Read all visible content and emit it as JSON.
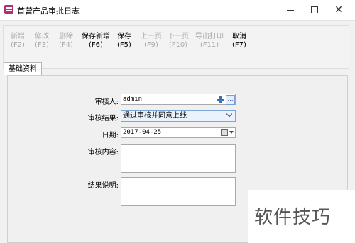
{
  "window": {
    "title": "首营产品审批日志"
  },
  "toolbar": {
    "buttons": [
      {
        "label": "新增",
        "key": "(F2)",
        "enabled": false
      },
      {
        "label": "修改",
        "key": "(F3)",
        "enabled": false
      },
      {
        "label": "删除",
        "key": "(F4)",
        "enabled": false
      },
      {
        "label": "保存新增",
        "key": "(F6)",
        "enabled": true
      },
      {
        "label": "保存",
        "key": "(F5)",
        "enabled": true
      },
      {
        "label": "上一页",
        "key": "(F9)",
        "enabled": false
      },
      {
        "label": "下一页",
        "key": "(F10)",
        "enabled": false
      },
      {
        "label": "导出打印",
        "key": "(F11)",
        "enabled": false
      },
      {
        "label": "取消",
        "key": "(F7)",
        "enabled": true
      }
    ]
  },
  "tabs": [
    {
      "label": "基础资料",
      "active": true
    }
  ],
  "form": {
    "reviewer_label": "审核人:",
    "reviewer_value": "admin",
    "result_label": "审核结果:",
    "result_value": "通过审核并同意上线",
    "date_label": "日期:",
    "date_value": "2017-04-25",
    "content_label": "审核内容:",
    "content_value": "",
    "note_label": "结果说明:",
    "note_value": ""
  },
  "watermark": {
    "text": "软件技巧"
  },
  "icons": {
    "app": "app-icon",
    "minimize": "minimize-icon",
    "maximize": "maximize-icon",
    "close": "close-icon",
    "add": "plus-icon",
    "browse": "ellipsis-icon",
    "dropdown": "chevron-down-icon",
    "calendar": "calendar-icon"
  }
}
